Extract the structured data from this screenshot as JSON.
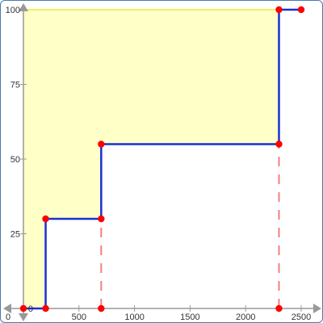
{
  "colors": {
    "axis": "#999999",
    "step_line": "#1a2fd6",
    "point": "#ff0000",
    "dashed": "#f08080",
    "fill": "#ffffc8",
    "fill_edge": "#eeee66"
  },
  "chart_data": {
    "type": "line",
    "title": "",
    "xlabel": "",
    "ylabel": "",
    "xlim": [
      0,
      2500
    ],
    "ylim": [
      0,
      100
    ],
    "grid": false,
    "x_ticks": [
      0,
      500,
      1000,
      1500,
      2000,
      2500
    ],
    "y_ticks": [
      0,
      25,
      50,
      75,
      100
    ],
    "series": [
      {
        "style": "step",
        "points": [
          [
            0,
            0
          ],
          [
            200,
            0
          ],
          [
            200,
            30
          ],
          [
            700,
            30
          ],
          [
            700,
            55
          ],
          [
            2300,
            55
          ],
          [
            2300,
            100
          ],
          [
            2500,
            100
          ]
        ]
      }
    ],
    "markers": [
      [
        0,
        0
      ],
      [
        200,
        0
      ],
      [
        700,
        0
      ],
      [
        2300,
        0
      ],
      [
        200,
        30
      ],
      [
        700,
        30
      ],
      [
        700,
        55
      ],
      [
        2300,
        55
      ],
      [
        2300,
        100
      ],
      [
        2500,
        100
      ]
    ],
    "dashed_verticals": [
      {
        "x": 700,
        "y_from": 0,
        "y_to": 30
      },
      {
        "x": 2300,
        "y_from": 0,
        "y_to": 55
      }
    ],
    "shaded_region": {
      "boundary": [
        [
          0,
          100
        ],
        [
          2300,
          100
        ],
        [
          2300,
          55
        ],
        [
          700,
          55
        ],
        [
          700,
          30
        ],
        [
          200,
          30
        ],
        [
          200,
          0
        ],
        [
          0,
          0
        ]
      ]
    }
  }
}
